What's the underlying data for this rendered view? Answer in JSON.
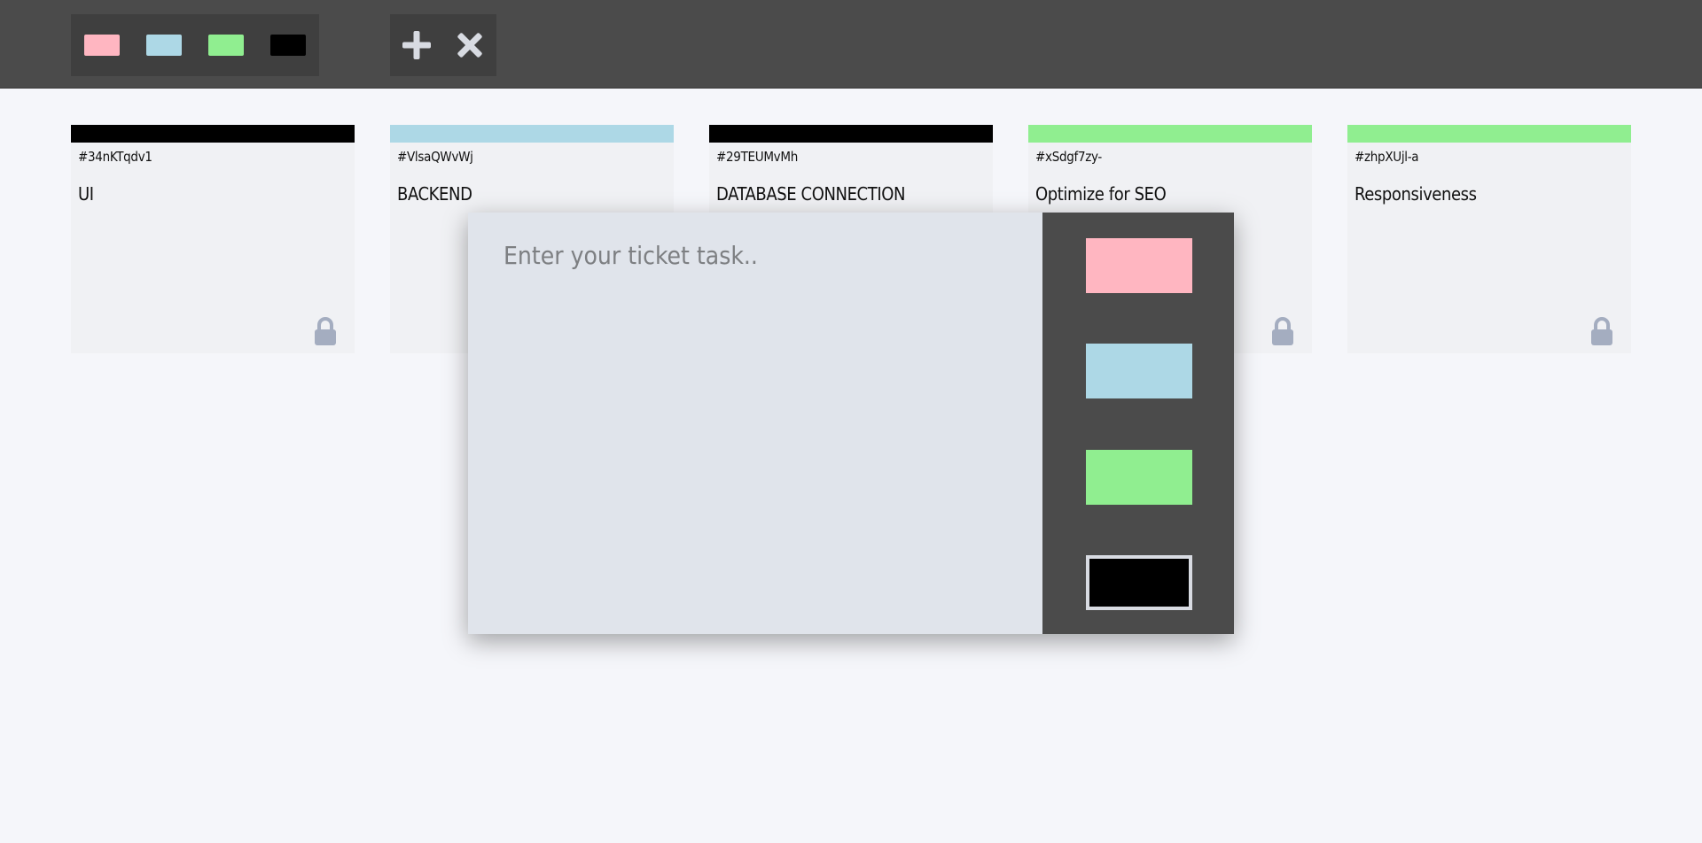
{
  "toolbar": {
    "filters": [
      {
        "name": "pink",
        "color": "#ffb6c1"
      },
      {
        "name": "lightblue",
        "color": "#add8e6"
      },
      {
        "name": "lightgreen",
        "color": "#90ee90"
      },
      {
        "name": "black",
        "color": "#000000"
      }
    ],
    "actions": [
      {
        "icon": "plus-icon"
      },
      {
        "icon": "close-icon"
      }
    ]
  },
  "tickets": [
    {
      "id": "#34nKTqdv1",
      "task": "UI",
      "color": "#000000",
      "icon": "lock-icon"
    },
    {
      "id": "#VlsaQWvWj",
      "task": "BACKEND",
      "color": "#add8e6",
      "icon": "lock-icon"
    },
    {
      "id": "#29TEUMvMh",
      "task": "DATABASE CONNECTION",
      "color": "#000000",
      "icon": "lock-icon"
    },
    {
      "id": "#xSdgf7zy-",
      "task": "Optimize for SEO",
      "color": "#90ee90",
      "icon": "lock-icon"
    },
    {
      "id": "#zhpXUjl-a",
      "task": "Responsiveness",
      "color": "#90ee90",
      "icon": "lock-icon"
    }
  ],
  "modal": {
    "placeholder": "Enter your ticket task..",
    "value": "",
    "colors": [
      {
        "name": "pink",
        "color": "#ffb6c1",
        "selected": false
      },
      {
        "name": "lightblue",
        "color": "#add8e6",
        "selected": false
      },
      {
        "name": "lightgreen",
        "color": "#90ee90",
        "selected": false
      },
      {
        "name": "black",
        "color": "#000000",
        "selected": true
      }
    ]
  }
}
